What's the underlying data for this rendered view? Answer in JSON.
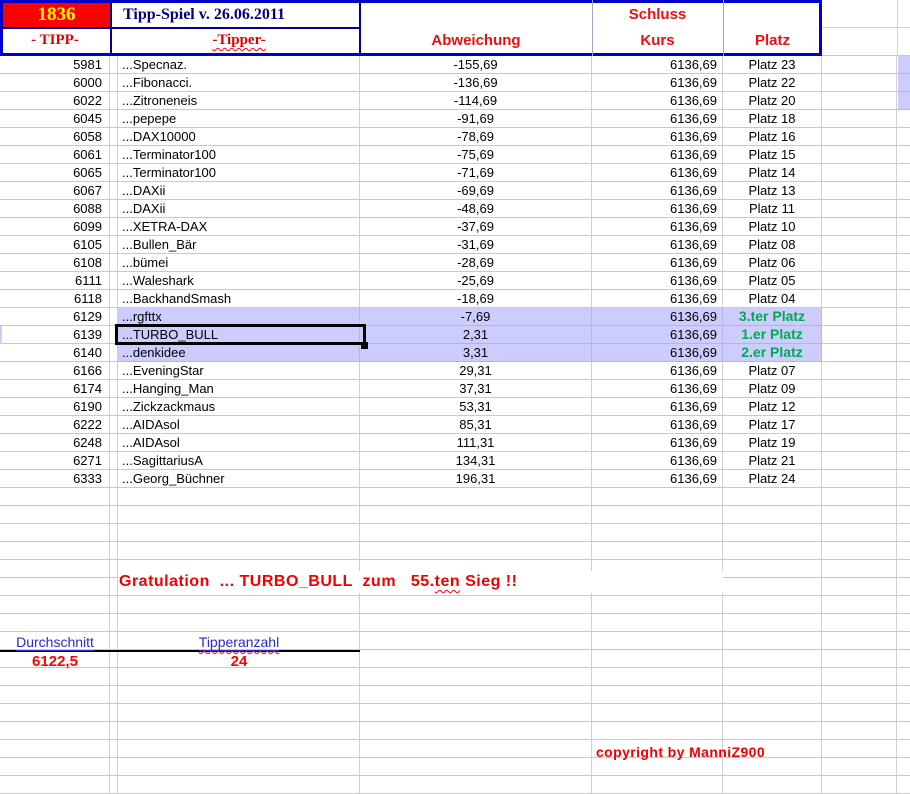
{
  "header": {
    "game_number": "1836",
    "title": "Tipp-Spiel v. 26.06.2011",
    "col_tipp": "- TIPP-",
    "col_tipper": "-Tipper-",
    "col_abweichung": "Abweichung",
    "col_schluss": "Schluss",
    "col_kurs": "Kurs",
    "col_platz": "Platz"
  },
  "rows": [
    {
      "tipp": "5981",
      "tipper": "...Specnaz.",
      "abweichung": "-155,69",
      "kurs": "6136,69",
      "platz": "Platz 23",
      "highlight": false,
      "green": false
    },
    {
      "tipp": "6000",
      "tipper": "...Fibonacci.",
      "abweichung": "-136,69",
      "kurs": "6136,69",
      "platz": "Platz 22",
      "highlight": false,
      "green": false
    },
    {
      "tipp": "6022",
      "tipper": "...Zitroneneis",
      "abweichung": "-114,69",
      "kurs": "6136,69",
      "platz": "Platz 20",
      "highlight": false,
      "green": false
    },
    {
      "tipp": "6045",
      "tipper": "...pepepe",
      "abweichung": "-91,69",
      "kurs": "6136,69",
      "platz": "Platz 18",
      "highlight": false,
      "green": false
    },
    {
      "tipp": "6058",
      "tipper": "...DAX10000",
      "abweichung": "-78,69",
      "kurs": "6136,69",
      "platz": "Platz 16",
      "highlight": false,
      "green": false
    },
    {
      "tipp": "6061",
      "tipper": "...Terminator100",
      "abweichung": "-75,69",
      "kurs": "6136,69",
      "platz": "Platz 15",
      "highlight": false,
      "green": false
    },
    {
      "tipp": "6065",
      "tipper": "...Terminator100",
      "abweichung": "-71,69",
      "kurs": "6136,69",
      "platz": "Platz 14",
      "highlight": false,
      "green": false
    },
    {
      "tipp": "6067",
      "tipper": "...DAXii",
      "abweichung": "-69,69",
      "kurs": "6136,69",
      "platz": "Platz 13",
      "highlight": false,
      "green": false
    },
    {
      "tipp": "6088",
      "tipper": "...DAXii",
      "abweichung": "-48,69",
      "kurs": "6136,69",
      "platz": "Platz 11",
      "highlight": false,
      "green": false
    },
    {
      "tipp": "6099",
      "tipper": "...XETRA-DAX",
      "abweichung": "-37,69",
      "kurs": "6136,69",
      "platz": "Platz 10",
      "highlight": false,
      "green": false
    },
    {
      "tipp": "6105",
      "tipper": "...Bullen_Bär",
      "abweichung": "-31,69",
      "kurs": "6136,69",
      "platz": "Platz 08",
      "highlight": false,
      "green": false
    },
    {
      "tipp": "6108",
      "tipper": "...bümei",
      "abweichung": "-28,69",
      "kurs": "6136,69",
      "platz": "Platz 06",
      "highlight": false,
      "green": false
    },
    {
      "tipp": "6111",
      "tipper": "...Waleshark",
      "abweichung": "-25,69",
      "kurs": "6136,69",
      "platz": "Platz 05",
      "highlight": false,
      "green": false
    },
    {
      "tipp": "6118",
      "tipper": "...BackhandSmash",
      "abweichung": "-18,69",
      "kurs": "6136,69",
      "platz": "Platz 04",
      "highlight": false,
      "green": false
    },
    {
      "tipp": "6129",
      "tipper": "...rgfttx",
      "abweichung": "-7,69",
      "kurs": "6136,69",
      "platz": "3.ter Platz",
      "highlight": true,
      "green": true
    },
    {
      "tipp": "6139",
      "tipper": "...TURBO_BULL",
      "abweichung": "2,31",
      "kurs": "6136,69",
      "platz": "1.er Platz",
      "highlight": true,
      "green": true,
      "selected": true
    },
    {
      "tipp": "6140",
      "tipper": "...denkidee",
      "abweichung": "3,31",
      "kurs": "6136,69",
      "platz": "2.er Platz",
      "highlight": true,
      "green": true
    },
    {
      "tipp": "6166",
      "tipper": "...EveningStar",
      "abweichung": "29,31",
      "kurs": "6136,69",
      "platz": "Platz 07",
      "highlight": false,
      "green": false
    },
    {
      "tipp": "6174",
      "tipper": "...Hanging_Man",
      "abweichung": "37,31",
      "kurs": "6136,69",
      "platz": "Platz 09",
      "highlight": false,
      "green": false
    },
    {
      "tipp": "6190",
      "tipper": "...Zickzackmaus",
      "abweichung": "53,31",
      "kurs": "6136,69",
      "platz": "Platz 12",
      "highlight": false,
      "green": false
    },
    {
      "tipp": "6222",
      "tipper": "...AIDAsol",
      "abweichung": "85,31",
      "kurs": "6136,69",
      "platz": "Platz 17",
      "highlight": false,
      "green": false
    },
    {
      "tipp": "6248",
      "tipper": "...AIDAsol",
      "abweichung": "111,31",
      "kurs": "6136,69",
      "platz": "Platz 19",
      "highlight": false,
      "green": false
    },
    {
      "tipp": "6271",
      "tipper": "...SagittariusA",
      "abweichung": "134,31",
      "kurs": "6136,69",
      "platz": "Platz 21",
      "highlight": false,
      "green": false
    },
    {
      "tipp": "6333",
      "tipper": "...Georg_Büchner",
      "abweichung": "196,31",
      "kurs": "6136,69",
      "platz": "Platz 24",
      "highlight": false,
      "green": false
    }
  ],
  "congrats": {
    "prefix": "Gratulation  ... TURBO_BULL  zum   55.",
    "wavy": "ten",
    "suffix": " Sieg !!"
  },
  "summary": {
    "durchschnitt_label": "Durchschnitt",
    "durchschnitt_value": "6122,5",
    "tipperanzahl_label": "Tipperanzahl",
    "tipperanzahl_value": "24"
  },
  "copyright": {
    "text": "copyright by ManniZ900"
  },
  "colors": {
    "header_cell_bg": "#ff0000",
    "header_cell_text": "#ffff00",
    "title_navy": "#000080",
    "accent_red": "#ff0000",
    "border_blue": "#0000cc",
    "highlight_lavender": "#ccccff",
    "rank_green": "#00a94f",
    "summary_label_blue": "#2a2ac8",
    "gridline": "#cfcfcf"
  }
}
